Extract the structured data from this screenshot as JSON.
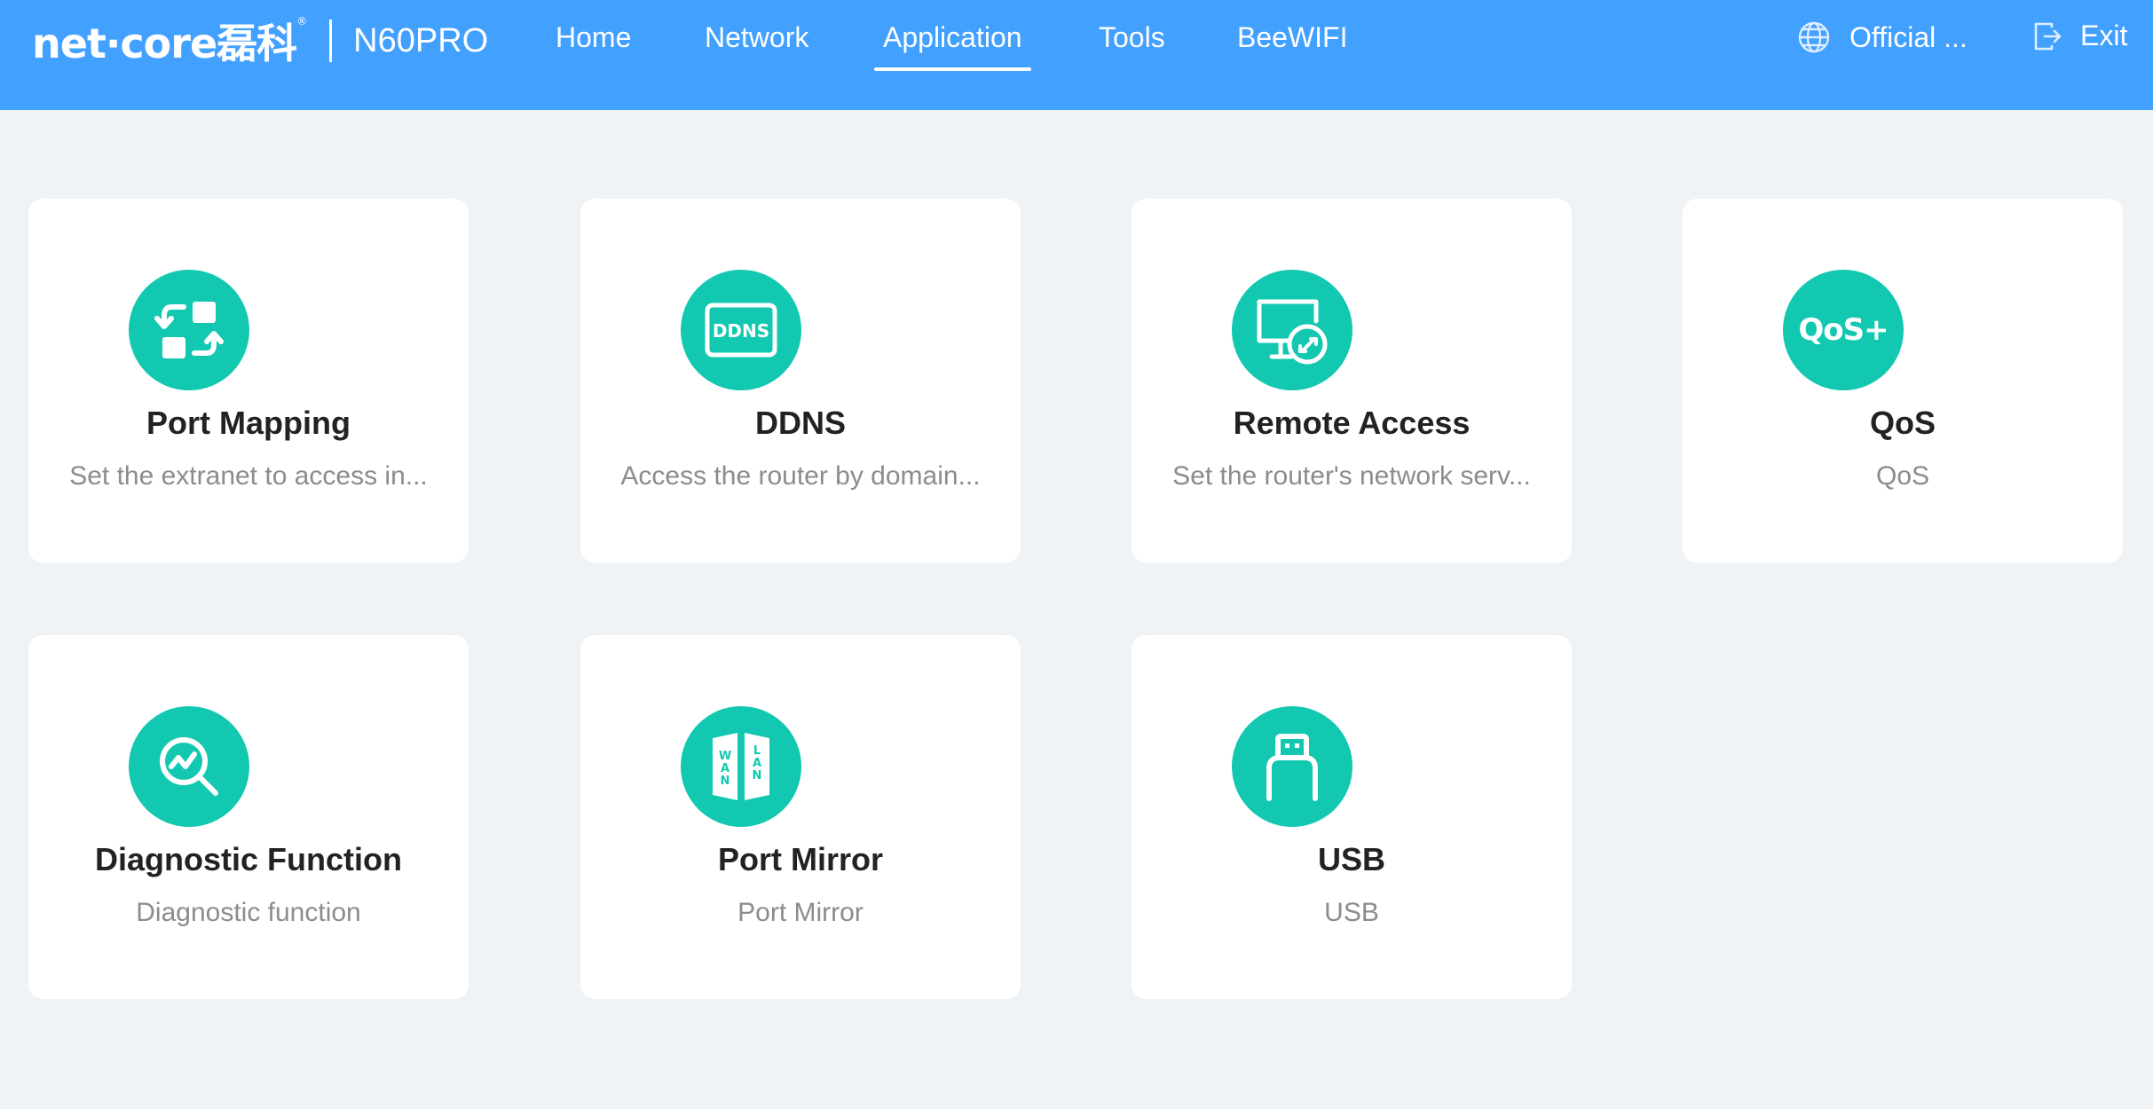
{
  "header": {
    "brand_logo": "net·core磊科",
    "brand_trademark": "®",
    "model": "N60PRO",
    "nav": [
      {
        "label": "Home"
      },
      {
        "label": "Network"
      },
      {
        "label": "Application",
        "active": true
      },
      {
        "label": "Tools"
      },
      {
        "label": "BeeWIFI"
      }
    ],
    "official_label": "Official ...",
    "official_icon": "globe-icon",
    "exit_label": "Exit",
    "exit_icon": "exit-icon"
  },
  "cards": [
    {
      "title": "Port Mapping",
      "desc": "Set the extranet to access in...",
      "icon": "port-mapping-icon"
    },
    {
      "title": "DDNS",
      "desc": "Access the router by domain...",
      "icon": "ddns-icon",
      "icon_text": "DDNS"
    },
    {
      "title": "Remote Access",
      "desc": "Set the router's network serv...",
      "icon": "remote-access-icon"
    },
    {
      "title": "QoS",
      "desc": "QoS",
      "icon": "qos-icon",
      "icon_text": "QoS+"
    },
    {
      "title": "Diagnostic Function",
      "desc": "Diagnostic function",
      "icon": "diagnostic-icon"
    },
    {
      "title": "Port Mirror",
      "desc": "Port Mirror",
      "icon": "port-mirror-icon",
      "icon_text_wan": "WAN",
      "icon_text_lan": "LAN"
    },
    {
      "title": "USB",
      "desc": "USB",
      "icon": "usb-icon"
    }
  ],
  "colors": {
    "header_bg": "#42a0ff",
    "page_bg": "#eff3f6",
    "icon_accent": "#12c8b0",
    "title_text": "#222222",
    "desc_text": "#8c8c8c"
  }
}
